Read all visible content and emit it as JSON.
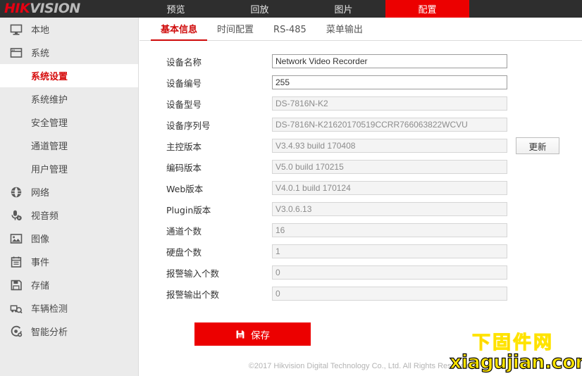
{
  "brand": {
    "part1": "HIK",
    "part2": "VISION"
  },
  "topnav": [
    {
      "label": "预览",
      "active": false
    },
    {
      "label": "回放",
      "active": false
    },
    {
      "label": "图片",
      "active": false
    },
    {
      "label": "配置",
      "active": true
    }
  ],
  "sidebar": {
    "items": [
      {
        "label": "本地",
        "icon": "monitor-icon",
        "type": "group"
      },
      {
        "label": "系统",
        "icon": "window-icon",
        "type": "group"
      },
      {
        "label": "系统设置",
        "type": "sub",
        "active": true
      },
      {
        "label": "系统维护",
        "type": "sub",
        "active": false
      },
      {
        "label": "安全管理",
        "type": "sub",
        "active": false
      },
      {
        "label": "通道管理",
        "type": "sub",
        "active": false
      },
      {
        "label": "用户管理",
        "type": "sub",
        "active": false
      },
      {
        "label": "网络",
        "icon": "globe-icon",
        "type": "group"
      },
      {
        "label": "视音频",
        "icon": "microphone-icon",
        "type": "group"
      },
      {
        "label": "图像",
        "icon": "image-icon",
        "type": "group"
      },
      {
        "label": "事件",
        "icon": "calendar-icon",
        "type": "group"
      },
      {
        "label": "存储",
        "icon": "save-disk-icon",
        "type": "group"
      },
      {
        "label": "车辆检测",
        "icon": "vehicle-search-icon",
        "type": "group"
      },
      {
        "label": "智能分析",
        "icon": "smart-analysis-icon",
        "type": "group"
      }
    ]
  },
  "tabs": [
    {
      "label": "基本信息",
      "active": true
    },
    {
      "label": "时间配置",
      "active": false
    },
    {
      "label": "RS-485",
      "active": false
    },
    {
      "label": "菜单输出",
      "active": false
    }
  ],
  "form": {
    "fields": [
      {
        "label": "设备名称",
        "value": "Network Video Recorder",
        "readonly": false,
        "name": "device-name"
      },
      {
        "label": "设备编号",
        "value": "255",
        "readonly": false,
        "name": "device-number"
      },
      {
        "label": "设备型号",
        "value": "DS-7816N-K2",
        "readonly": true,
        "name": "device-model"
      },
      {
        "label": "设备序列号",
        "value": "DS-7816N-K21620170519CCRR766063822WCVU",
        "readonly": true,
        "name": "device-serial"
      },
      {
        "label": "主控版本",
        "value": "V3.4.93 build 170408",
        "readonly": true,
        "name": "firmware-version",
        "button": "更新"
      },
      {
        "label": "编码版本",
        "value": "V5.0 build 170215",
        "readonly": true,
        "name": "encoding-version"
      },
      {
        "label": "Web版本",
        "value": "V4.0.1 build 170124",
        "readonly": true,
        "name": "web-version"
      },
      {
        "label": "Plugin版本",
        "value": "V3.0.6.13",
        "readonly": true,
        "name": "plugin-version"
      },
      {
        "label": "通道个数",
        "value": "16",
        "readonly": true,
        "name": "channel-count"
      },
      {
        "label": "硬盘个数",
        "value": "1",
        "readonly": true,
        "name": "hdd-count"
      },
      {
        "label": "报警输入个数",
        "value": "0",
        "readonly": true,
        "name": "alarm-in-count"
      },
      {
        "label": "报警输出个数",
        "value": "0",
        "readonly": true,
        "name": "alarm-out-count"
      }
    ],
    "save_label": "保存",
    "update_label": "更新"
  },
  "footer": {
    "copyright": "©2017 Hikvision Digital Technology Co., Ltd. All Rights Reserved."
  },
  "watermark": {
    "cn": "下固件网",
    "en": "xiagujian.com"
  },
  "colors": {
    "accent_red": "#ec0000",
    "active_red": "#cf0a0a",
    "header_dark": "#2e2e2e",
    "sidebar_bg": "#ebebeb",
    "watermark_red": "#ff0000",
    "watermark_yellow": "#ffe400"
  }
}
